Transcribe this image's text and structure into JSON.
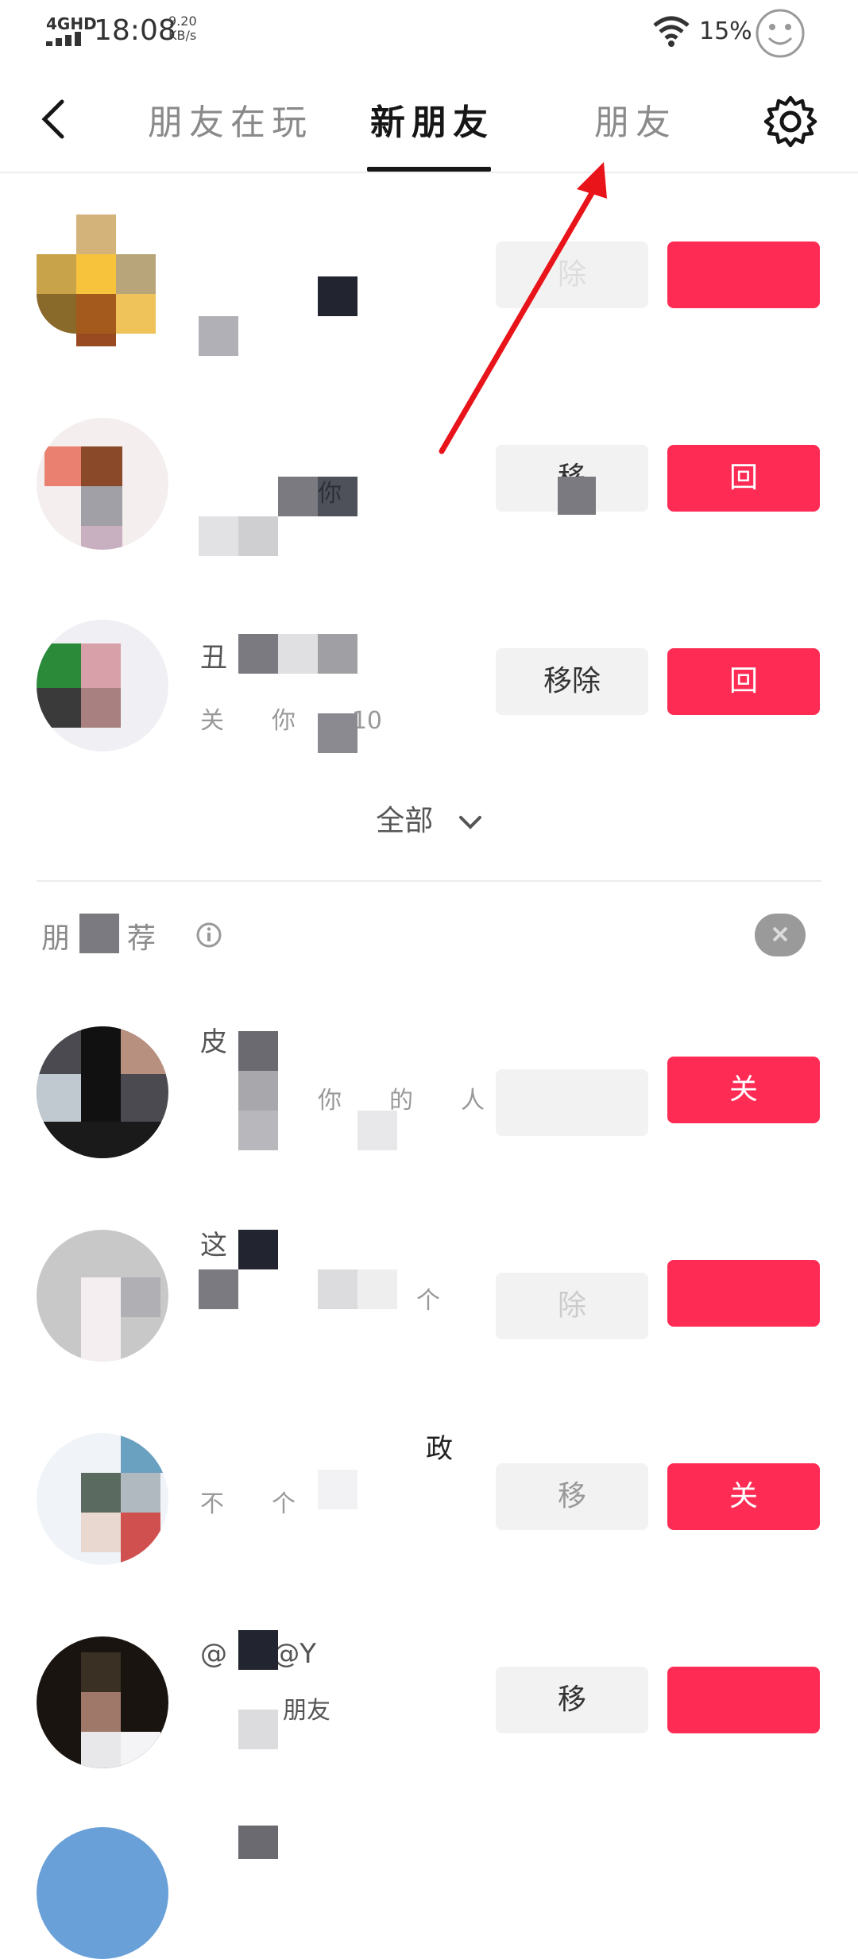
{
  "status_bar": {
    "network": "4GHD",
    "time": "18:08",
    "speed_value": "9.20",
    "speed_unit": "KB/s",
    "battery": "15%"
  },
  "nav": {
    "tabs": [
      {
        "label": "朋友在玩",
        "active": false
      },
      {
        "label": "新朋友",
        "active": true
      },
      {
        "label": "朋友",
        "active": false
      }
    ],
    "icons": {
      "back": "chevron-left-icon",
      "settings": "gear-icon"
    }
  },
  "new_friends": {
    "rows": [
      {
        "name": "",
        "sub": "",
        "remove_label": "除",
        "action_label": ""
      },
      {
        "name": "",
        "sub": "你",
        "remove_label": "移",
        "action_label": "回"
      },
      {
        "name": "丑",
        "sub": "关　　你　　-10",
        "remove_label": "移除",
        "action_label": "回"
      }
    ],
    "show_all_label": "全部",
    "show_all_icon": "chevron-down-icon"
  },
  "recommend": {
    "title": "朋　　荐",
    "info_icon": "info-icon",
    "rows": [
      {
        "name": "皮",
        "sub": "你　　的　　人",
        "remove_label": "",
        "action_label": "关"
      },
      {
        "name": "这",
        "sub": "个",
        "remove_label": "除",
        "action_label": ""
      },
      {
        "name": "政",
        "sub": "不　　个",
        "remove_label": "移",
        "action_label": "关"
      },
      {
        "name": "@　X@Y",
        "sub": "朋友",
        "remove_label": "移",
        "action_label": ""
      }
    ]
  },
  "colors": {
    "accent_red": "#fe2c55",
    "annotation_arrow": "#e8141a",
    "button_gray": "#f2f2f2"
  }
}
